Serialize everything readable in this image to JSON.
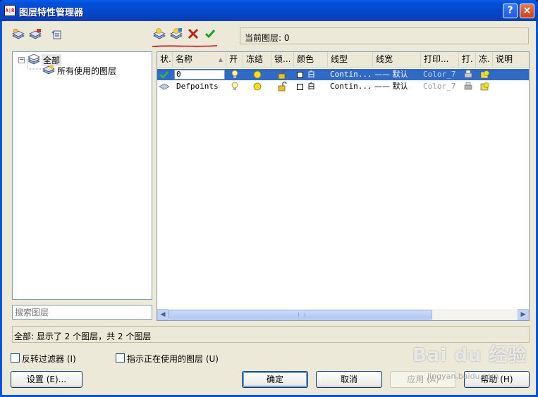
{
  "window": {
    "title": "图层特性管理器",
    "help": "?",
    "close": "×"
  },
  "current_layer": {
    "label": "当前图层: 0"
  },
  "tree": {
    "root": "全部",
    "child": "所有使用的图层",
    "collapse": "−"
  },
  "search": {
    "placeholder": "搜索图层"
  },
  "columns": [
    "状.",
    "名称",
    "开",
    "冻结",
    "锁...",
    "颜色",
    "线型",
    "线宽",
    "打印...",
    "打.",
    "冻.",
    "说明"
  ],
  "layers": [
    {
      "name": "0",
      "color": "白",
      "linetype": "Contin...",
      "lineweight": "—— 默认",
      "plotstyle": "Color_7"
    },
    {
      "name": "Defpoints",
      "color": "白",
      "linetype": "Contin...",
      "lineweight": "—— 默认",
      "plotstyle": "Color_7"
    }
  ],
  "status": "全部: 显示了 2 个图层，共 2 个图层",
  "options": {
    "invert_filter": "反转过滤器 (I)",
    "show_used": "指示正在使用的图层 (U)"
  },
  "buttons": {
    "settings": "设置 (E)...",
    "ok": "确定",
    "cancel": "取消",
    "apply": "应用 (A)",
    "help": "帮助 (H)"
  },
  "watermark": {
    "main": "Bai du 经验",
    "sub": "jingyan.baidu.com"
  },
  "colors": {
    "accent": "#316ac5",
    "title_bar": "#0446c8",
    "underline": "#d40000"
  }
}
